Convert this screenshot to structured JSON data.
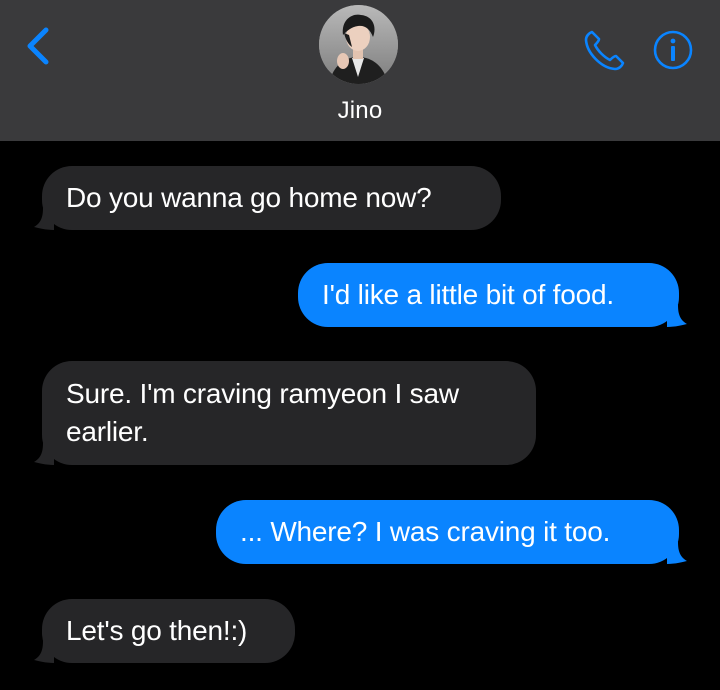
{
  "header": {
    "back_icon": "chevron-left-icon",
    "contact_name": "Jino",
    "phone_icon": "phone-icon",
    "info_icon": "info-icon",
    "accent_color": "#0a84ff",
    "background_color": "#3a3a3c"
  },
  "messages": [
    {
      "direction": "incoming",
      "text": "Do you wanna go home now?"
    },
    {
      "direction": "outgoing",
      "text": "I'd like a little bit of food."
    },
    {
      "direction": "incoming",
      "text": "Sure. I'm craving ramyeon I saw earlier."
    },
    {
      "direction": "outgoing",
      "text": "... Where? I was craving it too."
    },
    {
      "direction": "incoming",
      "text": "Let's go then!:)"
    }
  ],
  "colors": {
    "incoming_bubble": "#262628",
    "outgoing_bubble": "#0a84ff",
    "thread_background": "#000000"
  }
}
